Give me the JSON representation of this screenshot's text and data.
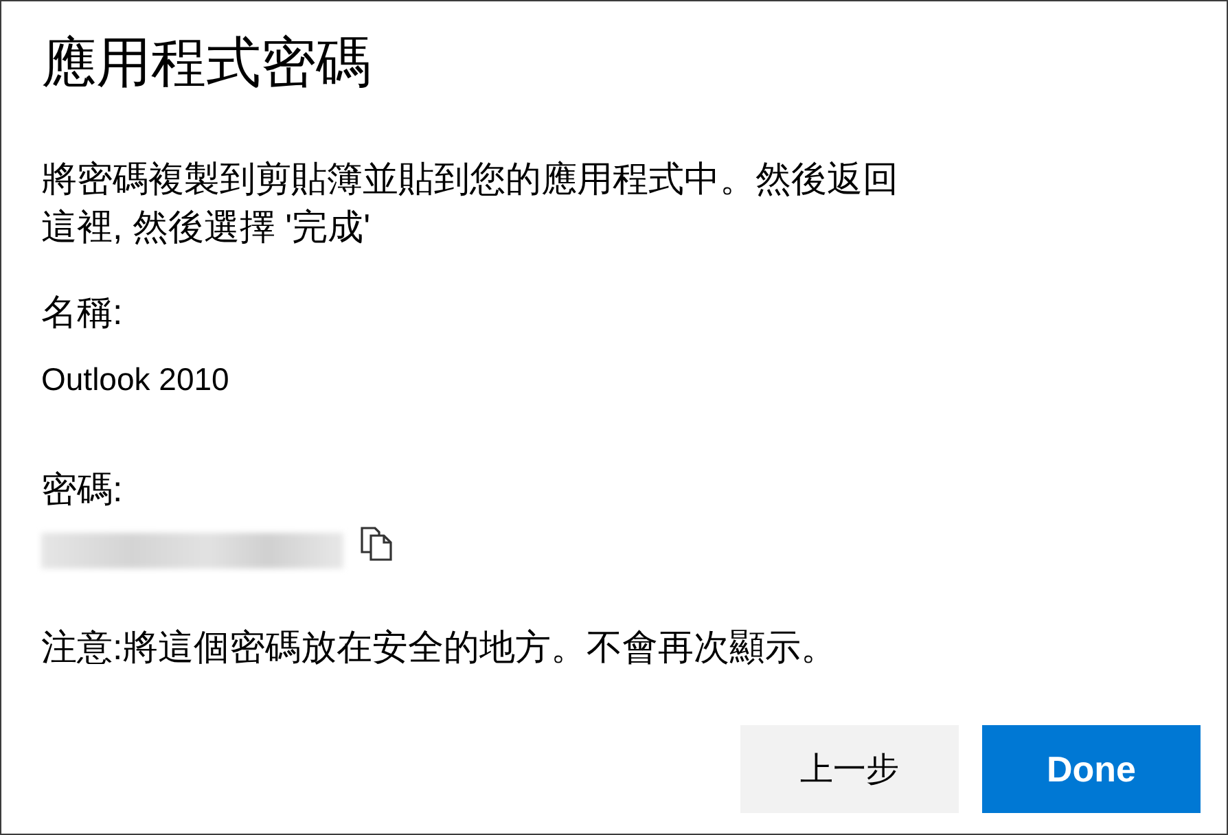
{
  "dialog": {
    "title": "應用程式密碼",
    "instructions": "將密碼複製到剪貼簿並貼到您的應用程式中。然後返回這裡, 然後選擇 '完成'",
    "name_label": "名稱:",
    "name_value": "Outlook 2010",
    "password_label": "密碼:",
    "note": "注意:將這個密碼放在安全的地方。不會再次顯示。"
  },
  "buttons": [
    {
      "label": "上一步",
      "kind": "secondary"
    },
    {
      "label": "Done",
      "kind": "primary"
    }
  ]
}
